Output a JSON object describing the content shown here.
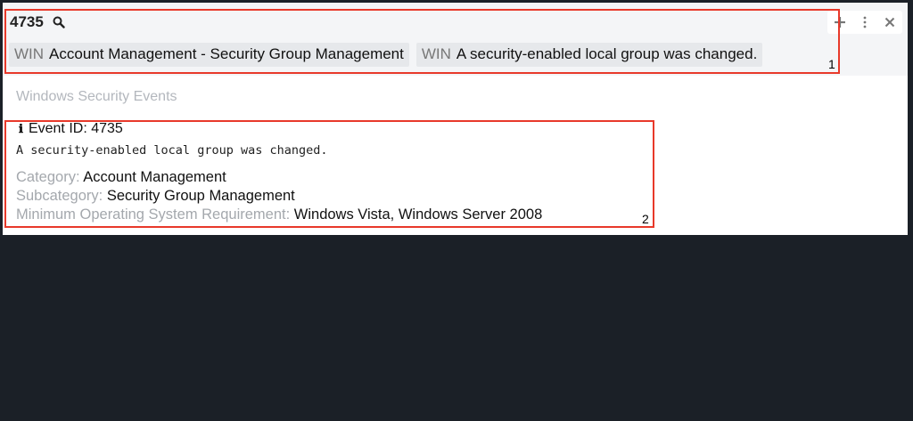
{
  "search": {
    "query": "4735"
  },
  "chips": [
    {
      "tag": "WIN",
      "label": "Account Management - Security Group Management"
    },
    {
      "tag": "WIN",
      "label": "A security-enabled local group was changed."
    }
  ],
  "toolbar": {
    "add_icon": "plus-icon",
    "menu_icon": "more-vertical-icon",
    "close_icon": "close-icon"
  },
  "annotations": {
    "box1": "1",
    "box2": "2",
    "color": "#e8392a"
  },
  "section": {
    "title": "Windows Security Events"
  },
  "event": {
    "id_label": "Event ID: 4735",
    "description": "A security-enabled local group was changed.",
    "fields": [
      {
        "key": "Category: ",
        "value": "Account Management"
      },
      {
        "key": "Subcategory: ",
        "value": "Security Group Management"
      },
      {
        "key": "Minimum Operating System Requirement: ",
        "value": "Windows Vista, Windows Server 2008"
      }
    ]
  }
}
